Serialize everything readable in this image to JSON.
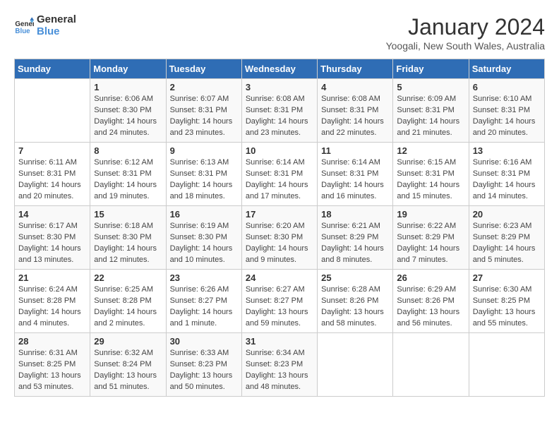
{
  "logo": {
    "line1": "General",
    "line2": "Blue"
  },
  "title": "January 2024",
  "location": "Yoogali, New South Wales, Australia",
  "days_of_week": [
    "Sunday",
    "Monday",
    "Tuesday",
    "Wednesday",
    "Thursday",
    "Friday",
    "Saturday"
  ],
  "weeks": [
    [
      {
        "num": "",
        "info": ""
      },
      {
        "num": "1",
        "info": "Sunrise: 6:06 AM\nSunset: 8:30 PM\nDaylight: 14 hours\nand 24 minutes."
      },
      {
        "num": "2",
        "info": "Sunrise: 6:07 AM\nSunset: 8:31 PM\nDaylight: 14 hours\nand 23 minutes."
      },
      {
        "num": "3",
        "info": "Sunrise: 6:08 AM\nSunset: 8:31 PM\nDaylight: 14 hours\nand 23 minutes."
      },
      {
        "num": "4",
        "info": "Sunrise: 6:08 AM\nSunset: 8:31 PM\nDaylight: 14 hours\nand 22 minutes."
      },
      {
        "num": "5",
        "info": "Sunrise: 6:09 AM\nSunset: 8:31 PM\nDaylight: 14 hours\nand 21 minutes."
      },
      {
        "num": "6",
        "info": "Sunrise: 6:10 AM\nSunset: 8:31 PM\nDaylight: 14 hours\nand 20 minutes."
      }
    ],
    [
      {
        "num": "7",
        "info": "Sunrise: 6:11 AM\nSunset: 8:31 PM\nDaylight: 14 hours\nand 20 minutes."
      },
      {
        "num": "8",
        "info": "Sunrise: 6:12 AM\nSunset: 8:31 PM\nDaylight: 14 hours\nand 19 minutes."
      },
      {
        "num": "9",
        "info": "Sunrise: 6:13 AM\nSunset: 8:31 PM\nDaylight: 14 hours\nand 18 minutes."
      },
      {
        "num": "10",
        "info": "Sunrise: 6:14 AM\nSunset: 8:31 PM\nDaylight: 14 hours\nand 17 minutes."
      },
      {
        "num": "11",
        "info": "Sunrise: 6:14 AM\nSunset: 8:31 PM\nDaylight: 14 hours\nand 16 minutes."
      },
      {
        "num": "12",
        "info": "Sunrise: 6:15 AM\nSunset: 8:31 PM\nDaylight: 14 hours\nand 15 minutes."
      },
      {
        "num": "13",
        "info": "Sunrise: 6:16 AM\nSunset: 8:31 PM\nDaylight: 14 hours\nand 14 minutes."
      }
    ],
    [
      {
        "num": "14",
        "info": "Sunrise: 6:17 AM\nSunset: 8:30 PM\nDaylight: 14 hours\nand 13 minutes."
      },
      {
        "num": "15",
        "info": "Sunrise: 6:18 AM\nSunset: 8:30 PM\nDaylight: 14 hours\nand 12 minutes."
      },
      {
        "num": "16",
        "info": "Sunrise: 6:19 AM\nSunset: 8:30 PM\nDaylight: 14 hours\nand 10 minutes."
      },
      {
        "num": "17",
        "info": "Sunrise: 6:20 AM\nSunset: 8:30 PM\nDaylight: 14 hours\nand 9 minutes."
      },
      {
        "num": "18",
        "info": "Sunrise: 6:21 AM\nSunset: 8:29 PM\nDaylight: 14 hours\nand 8 minutes."
      },
      {
        "num": "19",
        "info": "Sunrise: 6:22 AM\nSunset: 8:29 PM\nDaylight: 14 hours\nand 7 minutes."
      },
      {
        "num": "20",
        "info": "Sunrise: 6:23 AM\nSunset: 8:29 PM\nDaylight: 14 hours\nand 5 minutes."
      }
    ],
    [
      {
        "num": "21",
        "info": "Sunrise: 6:24 AM\nSunset: 8:28 PM\nDaylight: 14 hours\nand 4 minutes."
      },
      {
        "num": "22",
        "info": "Sunrise: 6:25 AM\nSunset: 8:28 PM\nDaylight: 14 hours\nand 2 minutes."
      },
      {
        "num": "23",
        "info": "Sunrise: 6:26 AM\nSunset: 8:27 PM\nDaylight: 14 hours\nand 1 minute."
      },
      {
        "num": "24",
        "info": "Sunrise: 6:27 AM\nSunset: 8:27 PM\nDaylight: 13 hours\nand 59 minutes."
      },
      {
        "num": "25",
        "info": "Sunrise: 6:28 AM\nSunset: 8:26 PM\nDaylight: 13 hours\nand 58 minutes."
      },
      {
        "num": "26",
        "info": "Sunrise: 6:29 AM\nSunset: 8:26 PM\nDaylight: 13 hours\nand 56 minutes."
      },
      {
        "num": "27",
        "info": "Sunrise: 6:30 AM\nSunset: 8:25 PM\nDaylight: 13 hours\nand 55 minutes."
      }
    ],
    [
      {
        "num": "28",
        "info": "Sunrise: 6:31 AM\nSunset: 8:25 PM\nDaylight: 13 hours\nand 53 minutes."
      },
      {
        "num": "29",
        "info": "Sunrise: 6:32 AM\nSunset: 8:24 PM\nDaylight: 13 hours\nand 51 minutes."
      },
      {
        "num": "30",
        "info": "Sunrise: 6:33 AM\nSunset: 8:23 PM\nDaylight: 13 hours\nand 50 minutes."
      },
      {
        "num": "31",
        "info": "Sunrise: 6:34 AM\nSunset: 8:23 PM\nDaylight: 13 hours\nand 48 minutes."
      },
      {
        "num": "",
        "info": ""
      },
      {
        "num": "",
        "info": ""
      },
      {
        "num": "",
        "info": ""
      }
    ]
  ]
}
